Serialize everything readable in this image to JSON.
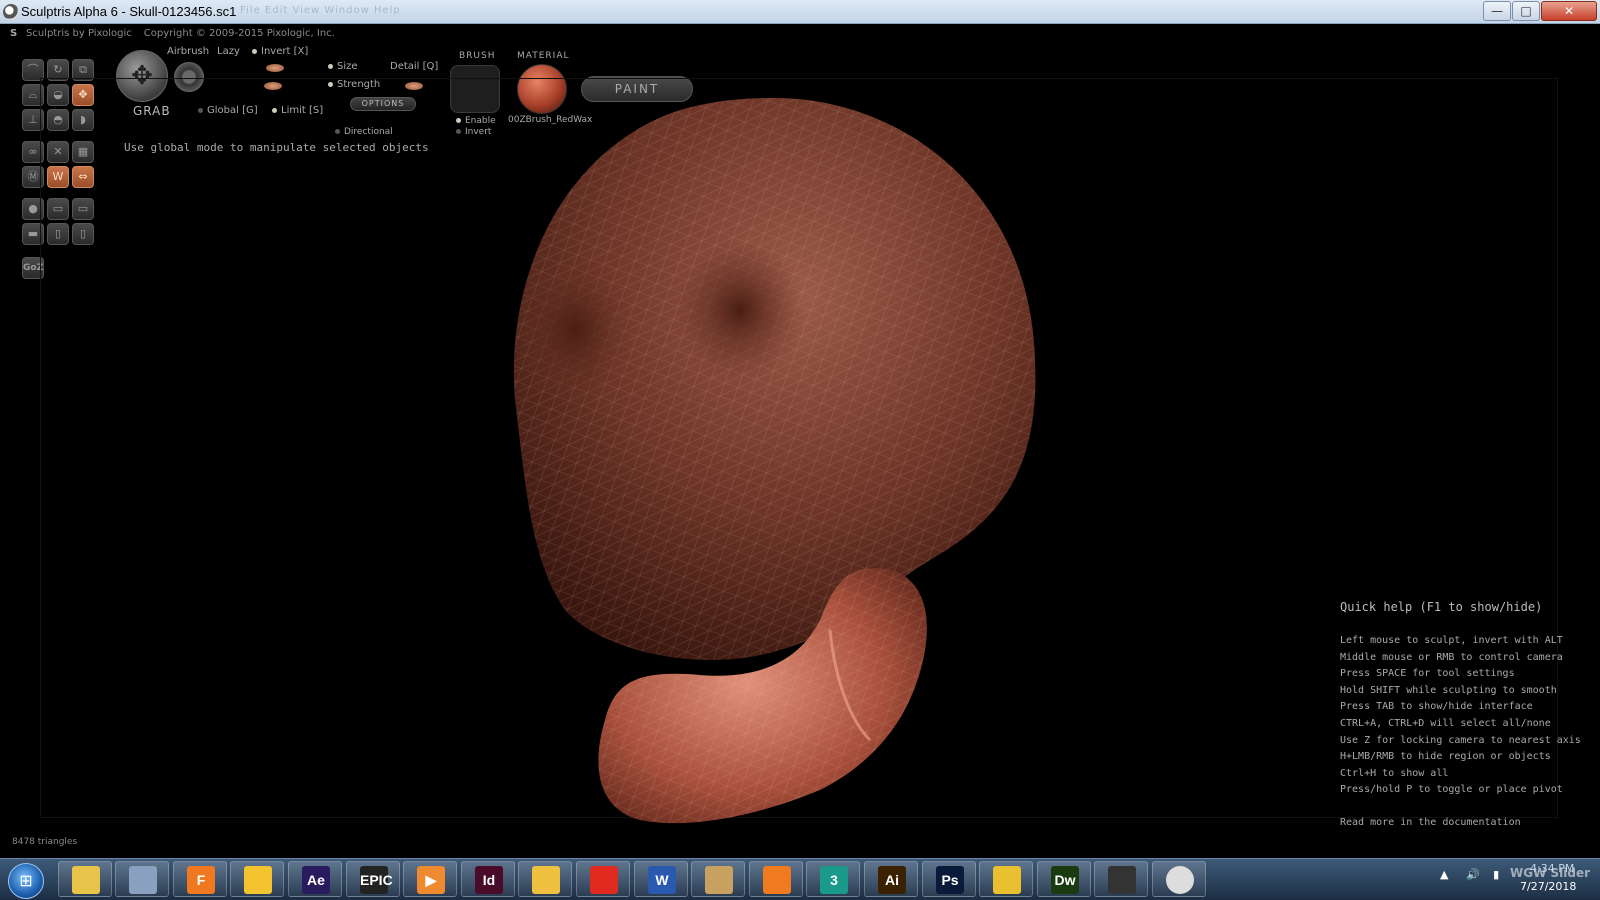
{
  "window": {
    "title": "Sculptris Alpha 6 - Skull-0123456.sc1",
    "faded_menu": "File  Edit  View  Window  Help",
    "min_label": "—",
    "max_label": "□",
    "close_label": "✕"
  },
  "header": {
    "credit": "Sculptris by Pixologic",
    "copyright": "Copyright © 2009-2015 Pixologic, Inc."
  },
  "toolbar": {
    "tool_name": "GRAB",
    "airbrush": "Airbrush",
    "lazy": "Lazy",
    "invert": "Invert [X]",
    "size": "Size",
    "detail": "Detail [Q]",
    "strength": "Strength",
    "options": "OPTIONS",
    "global": "Global [G]",
    "limit": "Limit [S]",
    "directional": "Directional",
    "hint": "Use global mode to manipulate selected objects",
    "brush_label": "BRUSH",
    "brush_enable": "Enable",
    "brush_invert": "Invert",
    "material_label": "MATERIAL",
    "material_name": "00ZBrush_RedWax",
    "paint_button": "PAINT",
    "goz": "GoZ"
  },
  "quick_help": {
    "title": "Quick help (F1 to show/hide)",
    "lines": [
      "Left mouse to sculpt, invert with ALT",
      "Middle mouse or RMB to control camera",
      "Press SPACE for tool settings",
      "Hold SHIFT while sculpting to smooth",
      "Press TAB to show/hide interface",
      "CTRL+A, CTRL+D will select all/none",
      "Use Z for locking camera to nearest axis",
      "H+LMB/RMB to hide region or objects",
      "Ctrl+H to show all",
      "Press/hold P to toggle or place pivot"
    ],
    "more": "Read more in the documentation"
  },
  "status": {
    "triangles": "8478 triangles"
  },
  "taskbar": {
    "items": [
      {
        "name": "explorer",
        "label": "",
        "color": "#e8c44a"
      },
      {
        "name": "3d-builder",
        "label": "",
        "color": "#8aa0c0"
      },
      {
        "name": "f-app",
        "label": "F",
        "color": "#f07820"
      },
      {
        "name": "photos",
        "label": "",
        "color": "#f4c430"
      },
      {
        "name": "after-effects",
        "label": "Ae",
        "color": "#2a1a5e"
      },
      {
        "name": "epic-games",
        "label": "EPIC",
        "color": "#222222"
      },
      {
        "name": "media-player",
        "label": "▶",
        "color": "#f08a30"
      },
      {
        "name": "indesign",
        "label": "Id",
        "color": "#4a0a2a"
      },
      {
        "name": "file-explorer",
        "label": "",
        "color": "#f0c040"
      },
      {
        "name": "acrobat",
        "label": "",
        "color": "#e02a20"
      },
      {
        "name": "word",
        "label": "W",
        "color": "#2a5ab0"
      },
      {
        "name": "file-manager",
        "label": "",
        "color": "#c8a060"
      },
      {
        "name": "firefox",
        "label": "",
        "color": "#f07a20"
      },
      {
        "name": "3ds-max",
        "label": "3",
        "color": "#1a9a8a"
      },
      {
        "name": "illustrator",
        "label": "Ai",
        "color": "#3a2200"
      },
      {
        "name": "photoshop",
        "label": "Ps",
        "color": "#0a1a3a"
      },
      {
        "name": "chrome",
        "label": "",
        "color": "#e8c030"
      },
      {
        "name": "dreamweaver",
        "label": "Dw",
        "color": "#1a3a10"
      },
      {
        "name": "camera-app",
        "label": "",
        "color": "#333333"
      },
      {
        "name": "sculptris",
        "label": "",
        "color": "#dddddd"
      }
    ],
    "time": "4:34 PM",
    "date": "7/27/2018",
    "watermark": "WGW Slider"
  }
}
